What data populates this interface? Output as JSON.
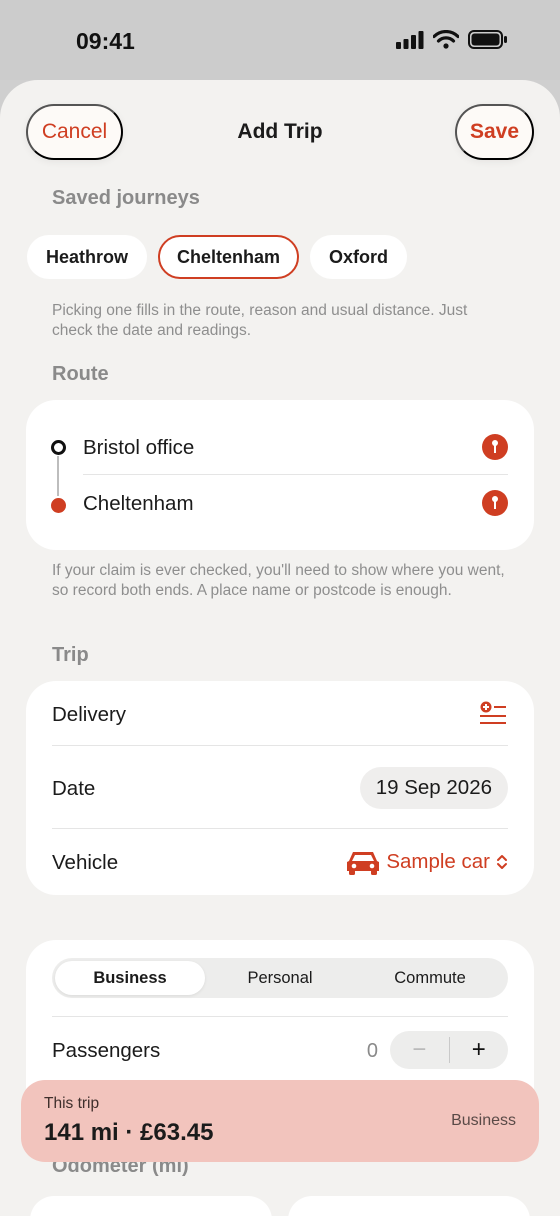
{
  "status_bar": {
    "time": "09:41"
  },
  "nav": {
    "cancel": "Cancel",
    "title": "Add Trip",
    "save": "Save"
  },
  "saved_journeys": {
    "label": "Saved journeys",
    "chips": [
      "Heathrow",
      "Cheltenham",
      "Oxford"
    ],
    "selected": "Cheltenham",
    "hint": "Picking one fills in the route, reason and usual distance. Just check the date and readings."
  },
  "route": {
    "label": "Route",
    "from": "Bristol office",
    "to": "Cheltenham",
    "hint": "If your claim is ever checked, you'll need to show where you went, so record both ends. A place name or postcode is enough."
  },
  "trip": {
    "label": "Trip",
    "reason": "Delivery",
    "date_label": "Date",
    "date_value": "19 Sep 2026",
    "vehicle_label": "Vehicle",
    "vehicle_value": "Sample car"
  },
  "purpose": {
    "segments": [
      "Business",
      "Personal",
      "Commute"
    ],
    "selected": "Business",
    "passengers_label": "Passengers",
    "passengers_value": "0",
    "minus": "−",
    "plus": "+"
  },
  "summary": {
    "label": "This trip",
    "value": "141 mi · £63.45",
    "type": "Business"
  },
  "odometer": {
    "label": "Odometer (mi)"
  },
  "colors": {
    "accent": "#cf3e22",
    "summary_bg": "#f2c4bd"
  }
}
